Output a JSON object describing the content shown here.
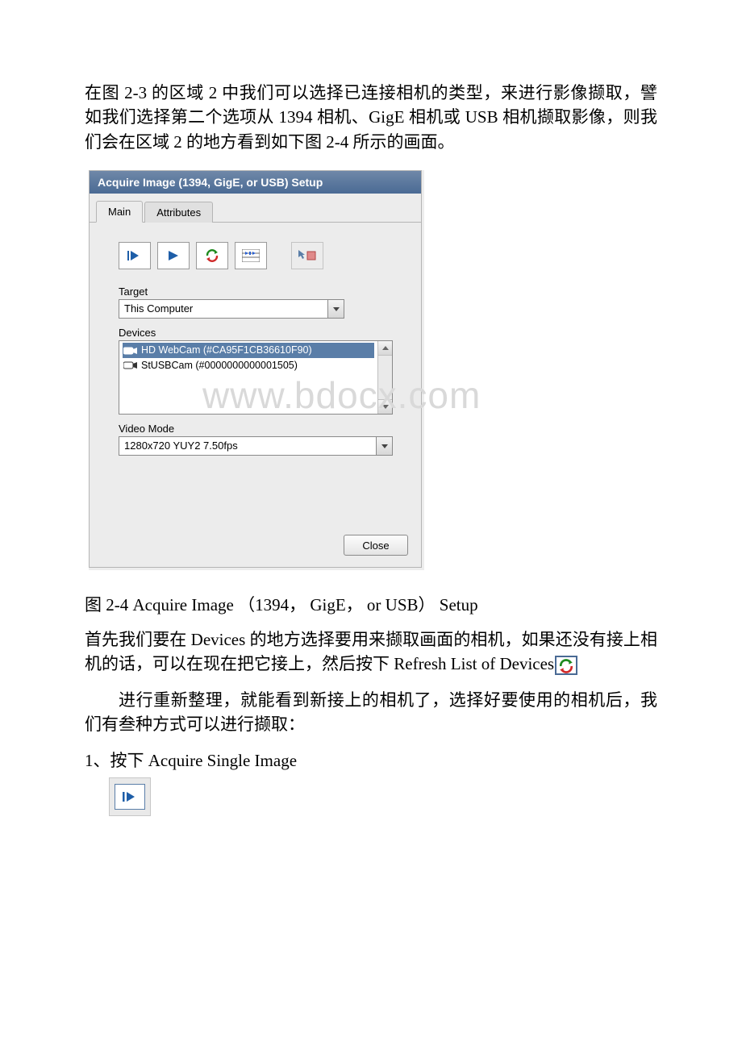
{
  "intro": "在图 2-3 的区域 2 中我们可以选择已连接相机的类型，来进行影像撷取，譬如我们选择第二个选项从 1394 相机、GigE 相机或 USB 相机撷取影像，则我们会在区域 2 的地方看到如下图 2-4 所示的画面。",
  "dialog": {
    "title": "Acquire Image (1394, GigE, or USB) Setup",
    "tabs": {
      "main": "Main",
      "attributes": "Attributes"
    },
    "labels": {
      "target": "Target",
      "devices": "Devices",
      "video_mode": "Video Mode"
    },
    "target_value": "This Computer",
    "devices_list": {
      "row0": "HD WebCam  (#CA95F1CB36610F90)",
      "row1": "StUSBCam  (#0000000000001505)"
    },
    "video_mode_value": "1280x720 YUY2 7.50fps",
    "close": "Close"
  },
  "watermark": "www.bdocx.com",
  "caption": "图 2-4 Acquire Image （1394， GigE， or USB） Setup",
  "para2a": "首先我们要在 Devices 的地方选择要用来撷取画面的相机，如果还没有接上相机的话，可以在现在把它接上，然后按下 Refresh List of Devices",
  "para3": "进行重新整理，就能看到新接上的相机了，选择好要使用的相机后，我们有叁种方式可以进行撷取：",
  "para4": "1、按下 Acquire Single Image"
}
